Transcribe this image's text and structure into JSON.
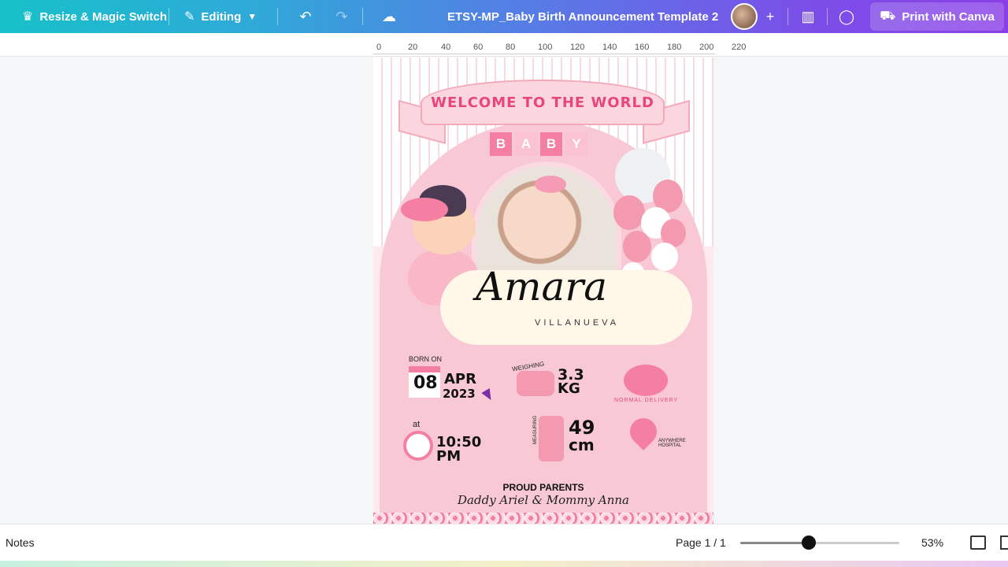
{
  "topbar": {
    "resize_label": "Resize & Magic Switch",
    "editing_label": "Editing",
    "doc_title": "ETSY-MP_Baby Birth Announcement Template 2",
    "print_label": "Print with Canva",
    "icons": [
      "crown-icon",
      "pencil-icon",
      "chevron-down-icon",
      "undo-icon",
      "redo-icon",
      "cloud-sync-icon",
      "plus-icon",
      "analytics-icon",
      "comment-icon",
      "truck-icon"
    ]
  },
  "ruler": {
    "ticks": [
      "0",
      "20",
      "40",
      "60",
      "80",
      "100",
      "120",
      "140",
      "160",
      "180",
      "200",
      "220"
    ]
  },
  "design": {
    "banner": "WELCOME TO THE WORLD",
    "baby_letters": [
      "B",
      "A",
      "B",
      "Y"
    ],
    "first_name": "Amara",
    "last_name": "VILLANUEVA",
    "born_on_label": "BORN ON",
    "day": "08",
    "month": "APR",
    "year": "2023",
    "weighing_label": "WEIGHING",
    "weight_value": "3.3",
    "weight_unit": "KG",
    "delivery_label": "NORMAL DELIVERY",
    "at_label": "at",
    "time": "10:50",
    "time_period": "PM",
    "measuring_label": "MEASURING",
    "length_value": "49",
    "length_unit": "cm",
    "hospital_label": "ANYWHERE HOSPITAL",
    "parents_title": "PROUD PARENTS",
    "parents_names": "Daddy Ariel & Mommy Anna"
  },
  "statusbar": {
    "notes_label": "Notes",
    "page_label": "Page 1 / 1",
    "zoom_label": "53%",
    "zoom_fraction": 0.43
  },
  "colors": {
    "accent_pink": "#e8467b",
    "light_pink": "#f8c9d4",
    "topbar_start": "#17c1c9",
    "topbar_end": "#8a3fe6"
  }
}
